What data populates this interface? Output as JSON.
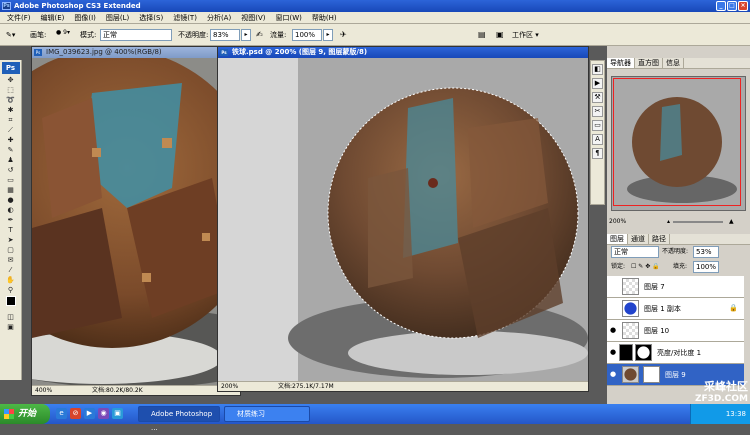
{
  "window": {
    "title": "Adobe Photoshop CS3 Extended",
    "app_icon": "Ps"
  },
  "menu": [
    "文件(F)",
    "编辑(E)",
    "图像(I)",
    "图层(L)",
    "选择(S)",
    "滤镜(T)",
    "分析(A)",
    "视图(V)",
    "窗口(W)",
    "帮助(H)"
  ],
  "options": {
    "brush_label": "画笔:",
    "brush_size": "9",
    "mode_label": "模式:",
    "mode_value": "正常",
    "opacity_label": "不透明度:",
    "opacity_value": "83%",
    "flow_label": "流量:",
    "flow_value": "100%",
    "workspace_label": "工作区"
  },
  "toolbox": {
    "logo": "Ps"
  },
  "documents": [
    {
      "title": "IMG_039623.jpg @ 400%(RGB/8)",
      "zoom": "400%",
      "info": "文档:80.2K/80.2K"
    },
    {
      "title": "铁球.psd @ 200% (图层 9, 图层蒙版/8)",
      "zoom": "200%",
      "info": "文档:275.1K/7.17M"
    }
  ],
  "navigator": {
    "tabs": [
      "导航器",
      "直方图",
      "信息"
    ],
    "zoom": "200%"
  },
  "layers_panel": {
    "tabs": [
      "图层",
      "通道",
      "路径"
    ],
    "blend_mode": "正常",
    "opacity_label": "不透明度:",
    "opacity_value": "53%",
    "lock_label": "锁定:",
    "fill_label": "填充:",
    "fill_value": "100%",
    "layers": [
      {
        "name": "图层 7"
      },
      {
        "name": "图层 1 副本"
      },
      {
        "name": "图层 10"
      },
      {
        "name": "亮度/对比度 1"
      },
      {
        "name": "图层 9"
      }
    ]
  },
  "taskbar": {
    "start": "开始",
    "buttons": [
      "Adobe Photoshop ...",
      "材质练习"
    ],
    "clock": "13:38"
  },
  "watermark": {
    "name": "ZF3D.COM",
    "label": "采峰社区"
  },
  "colors": {
    "titlebar": "#1848b8",
    "selection": "#3163c5",
    "taskbar": "#2456c8",
    "start": "#2b8a2a"
  }
}
